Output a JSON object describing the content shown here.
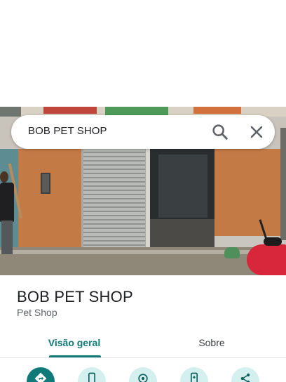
{
  "search": {
    "query": "BOB PET SHOP"
  },
  "place": {
    "name": "BOB PET SHOP",
    "category": "Pet Shop"
  },
  "tabs": [
    {
      "label": "Visão geral",
      "selected": true
    },
    {
      "label": "Sobre",
      "selected": false
    }
  ],
  "actions": [
    {
      "icon": "directions-icon"
    },
    {
      "icon": "phone-icon"
    },
    {
      "icon": "location-pin-icon"
    },
    {
      "icon": "send-to-device-icon"
    },
    {
      "icon": "share-icon"
    }
  ],
  "colors": {
    "accent": "#0f7a78",
    "action_light": "#d4f0ee",
    "text_primary": "#202124",
    "text_secondary": "#5f6368"
  }
}
